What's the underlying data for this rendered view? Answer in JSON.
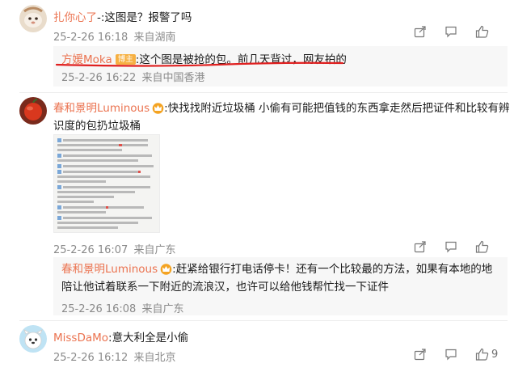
{
  "comments": [
    {
      "user": "扎你心了",
      "sep": "-:",
      "text": "这图是？报警了吗",
      "time": "25-2-26 16:18",
      "location": "来自湖南",
      "reply": {
        "user": "方媛Moka",
        "badge": "博主",
        "sep": ":",
        "text": "这个图是被抢的包。前几天背过，网友拍的",
        "time": "25-2-26 16:22",
        "location": "来自中国香港"
      }
    },
    {
      "user": "春和景明Luminous",
      "sep": ":",
      "text_line1": "快找找附近垃圾桶 小偷有可能把值钱的东西拿走然后把证件和比较有辨",
      "text_line2": "识度的包扔垃圾桶",
      "time": "25-2-26 16:07",
      "location": "来自广东",
      "reply": {
        "user": "春和景明Luminous",
        "sep": ":",
        "text_line1": "赶紧给银行打电话停卡！还有一个比较最的方法，如果有本地的地",
        "text_line2": "陪让他试着联系一下附近的流浪汉，也许可以给他钱帮忙找一下证件",
        "time": "25-2-26 16:08",
        "location": "来自广东"
      }
    },
    {
      "user": "MissDaMo",
      "sep": ":",
      "text": "意大利全是小偷",
      "time": "25-2-26 16:12",
      "location": "来自北京",
      "like_count": "9"
    }
  ],
  "colors": {
    "username": "#eb7350",
    "meta": "#8a8a8a",
    "annotation_underline": "#e02020",
    "badge": "#f6b042"
  },
  "icons": [
    "share-icon",
    "comment-icon",
    "thumbs-up-icon",
    "crown-icon"
  ]
}
